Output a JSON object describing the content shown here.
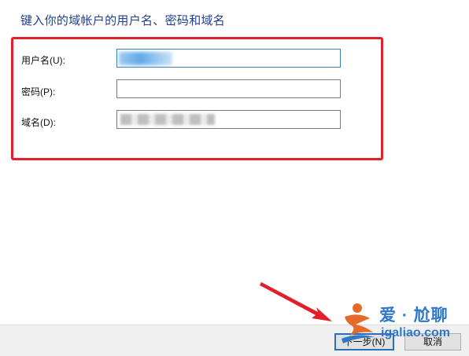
{
  "dialog": {
    "heading": "键入你的域帐户的用户名、密码和域名",
    "fields": {
      "username": {
        "label": "用户名(U):",
        "value": ""
      },
      "password": {
        "label": "密码(P):",
        "value": ""
      },
      "domain": {
        "label": "域名(D):",
        "value": ""
      }
    }
  },
  "buttons": {
    "next_label": "下一步(N)",
    "cancel_label": "取消"
  },
  "watermark": {
    "title": "爱 · 尬聊",
    "url": "igaliao.com"
  },
  "colors": {
    "heading": "#1f3f8f",
    "highlight_box": "#e0202a",
    "annotation_arrow": "#e0202a",
    "focus_border": "#2a6ebd",
    "watermark": "#2f78c8"
  },
  "icons": [
    "annotation-arrow-icon",
    "watermark-logo-icon"
  ]
}
